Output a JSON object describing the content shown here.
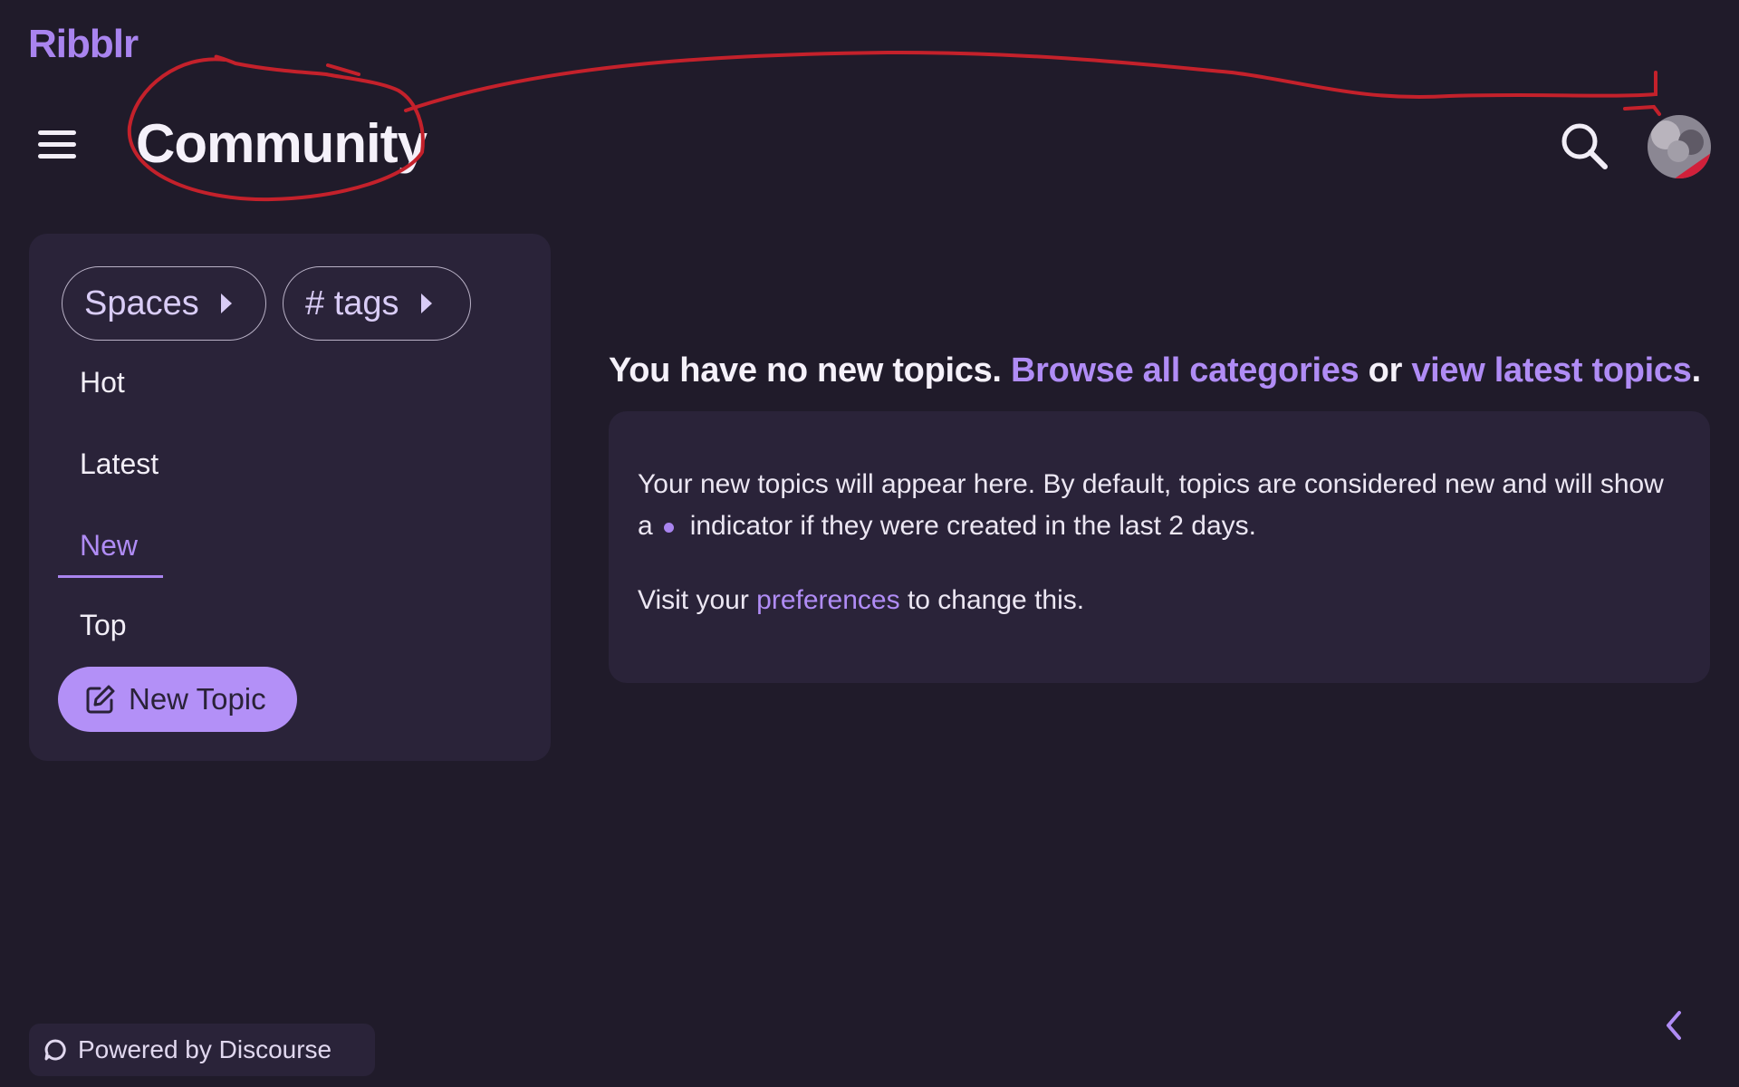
{
  "header": {
    "logo": "Ribblr",
    "title": "Community",
    "menu_icon": "hamburger-menu-icon",
    "search_icon": "search-icon",
    "avatar_icon": "user-avatar"
  },
  "sidebar": {
    "pills": [
      {
        "label": "Spaces",
        "icon": "caret-right-icon"
      },
      {
        "label": "# tags",
        "icon": "caret-right-icon"
      }
    ],
    "nav": [
      {
        "label": "Hot"
      },
      {
        "label": "Latest"
      },
      {
        "label": "New",
        "active": true
      },
      {
        "label": "Top"
      }
    ],
    "new_topic": {
      "label": "New Topic",
      "icon": "edit-icon"
    }
  },
  "main": {
    "headline": {
      "text": "You have no new topics.",
      "link1": "Browse all categories",
      "or": "or",
      "link2": "view latest topics",
      "end": "."
    },
    "info": {
      "line1": "Your new topics will appear here. By default, topics are considered new and will show a",
      "line1_after": "indicator if they were created in the last 2 days.",
      "line2_pre": "Visit your",
      "line2_link": "preferences",
      "line2_post": "to change this."
    }
  },
  "footer": {
    "powered_by": "Powered by Discourse",
    "collapse_icon": "chevron-left-icon"
  },
  "colors": {
    "background": "#201b2a",
    "panel": "#2a2339",
    "accent": "#a984ef",
    "annotation": "#c4212b"
  }
}
